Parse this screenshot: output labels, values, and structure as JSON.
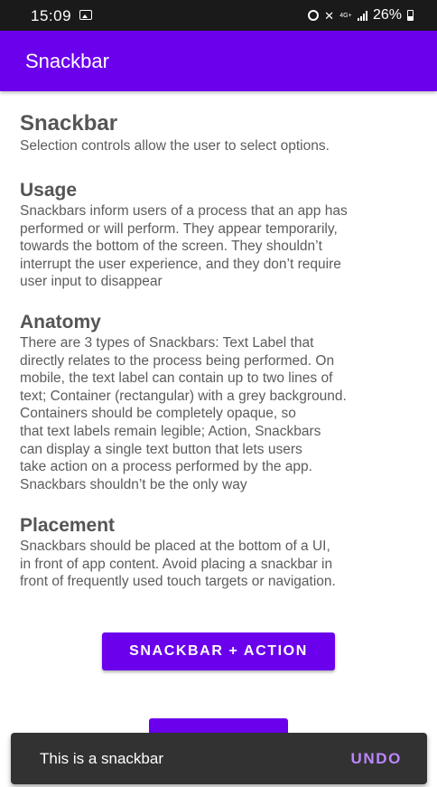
{
  "status_bar": {
    "time": "15:09",
    "network": "4G+",
    "battery": "26%"
  },
  "app_bar": {
    "title": "Snackbar"
  },
  "content": {
    "title": "Snackbar",
    "subtitle": "Selection controls allow the user to select options.",
    "sections": [
      {
        "title": "Usage",
        "lines": [
          "Snackbars inform users of a process that an app has",
          "performed or will perform. They appear temporarily,",
          "towards the bottom of the screen. They shouldn’t",
          "interrupt the user experience, and they don’t require",
          "user input to disappear"
        ]
      },
      {
        "title": "Anatomy",
        "lines": [
          "There are 3 types of Snackbars: Text Label that",
          "directly relates to the process being performed. On",
          "mobile, the text label can contain up to two lines of",
          "text; Container (rectangular) with a grey background.",
          "Containers should be completely opaque, so",
          "that text labels remain legible; Action, Snackbars",
          "can display a single text button that lets users",
          "take action on a process performed by the app.",
          "Snackbars shouldn’t be the only way"
        ]
      },
      {
        "title": "Placement",
        "lines": [
          "Snackbars should be placed at the bottom of a UI,",
          "in front of app content. Avoid placing a snackbar in",
          "front of frequently used touch targets or navigation."
        ]
      }
    ]
  },
  "buttons": {
    "snackbar_action_label": "SNACKBAR + ACTION"
  },
  "snackbar": {
    "message": "This is a snackbar",
    "action_label": "UNDO"
  },
  "colors": {
    "primary": "#6b00ed",
    "status_bar": "#1a1a1a",
    "snackbar_bg": "#323232",
    "snackbar_action": "#bb86fc"
  },
  "icons": {
    "status": [
      "photo-icon",
      "alarm-icon",
      "mute-icon",
      "network-icon",
      "signal-icon",
      "battery-icon"
    ]
  }
}
